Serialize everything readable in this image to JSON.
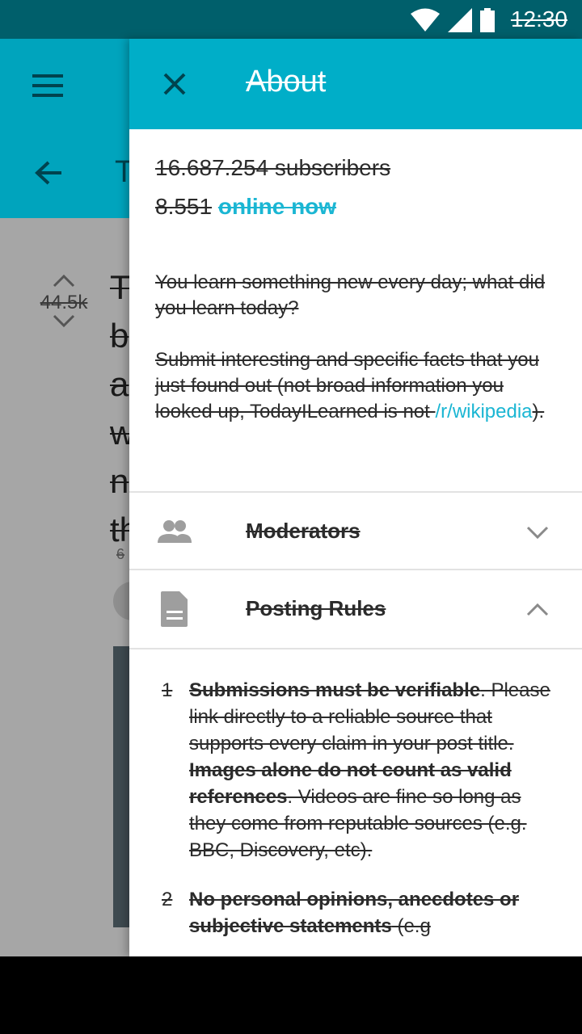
{
  "status_bar": {
    "time": "12:30"
  },
  "background": {
    "vote_score": "44.5k",
    "title_letters": "T\nb\na\nw\nn\nth",
    "meta": "6"
  },
  "drawer": {
    "title": "About",
    "subscribers": "16.687.254 subscribers",
    "online_count": "8.551",
    "online_label": "online now",
    "description": {
      "p1": "You learn something new every day; what did you learn today?",
      "p2_prefix": "Submit interesting and specific facts that you just found out (not broad information you looked up, TodayILearned is not ",
      "p2_link": "/r/wikipedia",
      "p2_suffix": ")."
    },
    "sections": [
      {
        "label": "Moderators",
        "icon": "people-icon",
        "expanded": false
      },
      {
        "label": "Posting Rules",
        "icon": "document-icon",
        "expanded": true
      }
    ],
    "rules": [
      {
        "num": "1",
        "bold1": "Submissions must be verifiable",
        "text1": ". Please link directly to a reliable source that supports every claim in your post title. ",
        "bold2": "Images alone do not count as valid references",
        "text2": ". Videos are fine so long as they come from reputable sources (e.g. BBC, Discovery, etc)."
      },
      {
        "num": "2",
        "bold1": "No personal opinions, anecdotes or subjective statements",
        "text1": " (e.g"
      }
    ]
  },
  "colors": {
    "header": "#00aec8",
    "accent_link": "#1bb6d3",
    "status_bar": "#005f6b"
  }
}
